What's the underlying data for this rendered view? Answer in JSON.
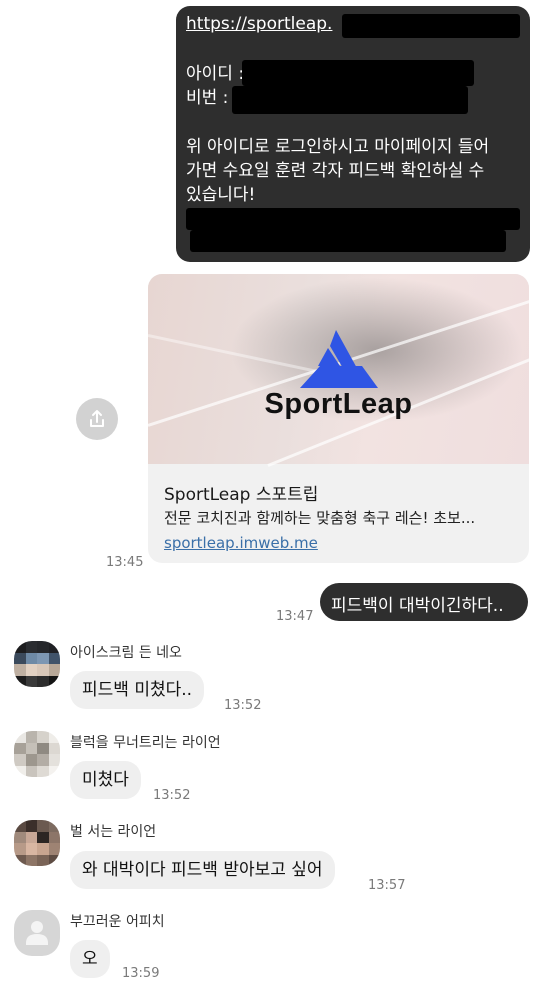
{
  "sent_message": {
    "url_text": "https://sportleap.",
    "id_label": "아이디 :",
    "pw_label": "비번 :",
    "body_line1": "위 아이디로 로그인하시고 마이페이지 들어",
    "body_line2": "가면 수요일 훈련 각자 피드백 확인하실 수",
    "body_line3": "있습니다!"
  },
  "link_card": {
    "logo_text": "SportLeap",
    "title": "SportLeap 스포트립",
    "description": "전문 코치진과 함께하는 맞춤형 축구 레슨! 초보...",
    "link": "sportleap.imweb.me",
    "time": "13:45"
  },
  "sent_reply": {
    "text": "피드백이 대박이긴하다..",
    "time": "13:47"
  },
  "received": [
    {
      "sender": "아이스크림 든 네오",
      "text": "피드백 미쳤다..",
      "time": "13:52"
    },
    {
      "sender": "블럭을 무너트리는 라이언",
      "text": "미쳤다",
      "time": "13:52"
    },
    {
      "sender": "벌 서는 라이언",
      "text": "와 대박이다 피드백 받아보고 싶어",
      "time": "13:57"
    },
    {
      "sender": "부끄러운 어피치",
      "text": "오",
      "time": "13:59"
    }
  ],
  "colors": {
    "dark_bubble": "#2e2e2e",
    "light_bubble": "#efefef",
    "logo_blue": "#2f55e4",
    "link_blue": "#3a6fa8"
  },
  "icons": {
    "share": "share-icon",
    "default_avatar": "person-silhouette-icon"
  }
}
